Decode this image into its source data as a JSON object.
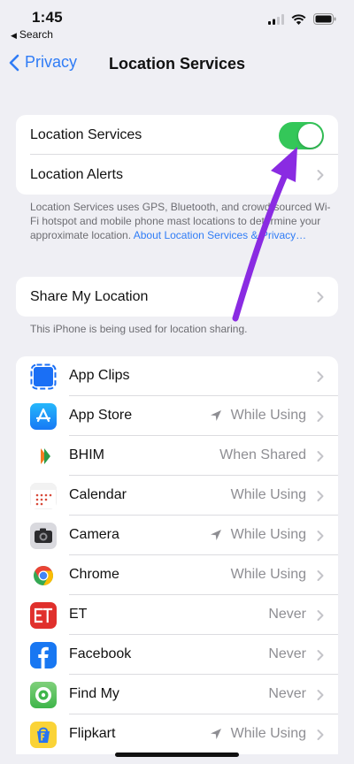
{
  "status_bar": {
    "time": "1:45",
    "back_app": "Search"
  },
  "nav": {
    "back_label": "Privacy",
    "title": "Location Services"
  },
  "location_group": {
    "services_label": "Location Services",
    "services_enabled": true,
    "alerts_label": "Location Alerts"
  },
  "location_footnote": {
    "text": "Location Services uses GPS, Bluetooth, and crowd-sourced Wi-Fi hotspot and mobile phone mast locations to determine your approximate location. ",
    "link": "About Location Services & Privacy…"
  },
  "share_group": {
    "label": "Share My Location"
  },
  "share_footnote": "This iPhone is being used for location sharing.",
  "apps": [
    {
      "name": "App Clips",
      "status": "",
      "arrow": false
    },
    {
      "name": "App Store",
      "status": "While Using",
      "arrow": true
    },
    {
      "name": "BHIM",
      "status": "When Shared",
      "arrow": false
    },
    {
      "name": "Calendar",
      "status": "While Using",
      "arrow": false
    },
    {
      "name": "Camera",
      "status": "While Using",
      "arrow": true
    },
    {
      "name": "Chrome",
      "status": "While Using",
      "arrow": false
    },
    {
      "name": "ET",
      "status": "Never",
      "arrow": false
    },
    {
      "name": "Facebook",
      "status": "Never",
      "arrow": false
    },
    {
      "name": "Find My",
      "status": "Never",
      "arrow": false
    },
    {
      "name": "Flipkart",
      "status": "While Using",
      "arrow": true
    }
  ],
  "colors": {
    "accent": "#2f7cf6",
    "toggle_on": "#34c759",
    "annotation_arrow": "#8a2be2"
  },
  "icons": [
    "search-back-icon",
    "signal-icon",
    "wifi-icon",
    "battery-icon",
    "chevron-left-icon",
    "chevron-right-icon",
    "location-arrow-icon"
  ]
}
